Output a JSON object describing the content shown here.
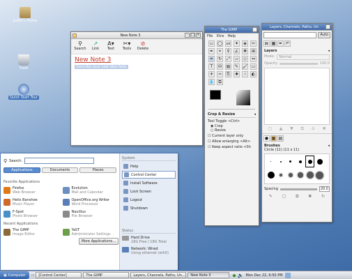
{
  "desktop": {
    "icons": [
      {
        "label": "judith's Home",
        "icon": "home-folder-icon"
      },
      {
        "label": "Trash",
        "icon": "trash-icon"
      },
      {
        "label": "Quick Start Tour",
        "icon": "help-icon"
      }
    ]
  },
  "note": {
    "title": "New Note 3",
    "toolbar": [
      {
        "label": "Search",
        "icon": "search-icon"
      },
      {
        "label": "Link",
        "icon": "link-icon"
      },
      {
        "label": "Text",
        "icon": "text-icon"
      },
      {
        "label": "Tools",
        "icon": "tools-icon"
      },
      {
        "label": "Delete",
        "icon": "delete-icon"
      }
    ],
    "heading": "New Note 3",
    "body": "Describe your new idea here."
  },
  "gimp_toolbox": {
    "title": "The GIMP",
    "menus": [
      "File",
      "Xtns",
      "Help"
    ],
    "options_title": "Crop & Resize",
    "tool_toggle": "Tool Toggle <Ctrl>",
    "radio_crop": "Crop",
    "radio_resize": "Resize",
    "opt_current_layer": "Current layer only",
    "opt_allow_enlarge": "Allow enlarging <Alt>",
    "opt_keep_aspect": "Keep aspect ratio <Sh"
  },
  "gimp_layers": {
    "title": "Layers, Channels, Paths, Un",
    "auto": "Auto",
    "layers_title": "Layers",
    "mode_label": "Mode:",
    "mode_value": "Normal",
    "opacity_label": "Opacity",
    "opacity_value": "100.0",
    "brushes_title": "Brushes",
    "brush_name": "Circle (11) (11 x 11)",
    "spacing_label": "Spacing",
    "spacing_value": "20.0"
  },
  "start_menu": {
    "search_label": "Search:",
    "tabs": [
      "Applications",
      "Documents",
      "Places"
    ],
    "favorites_title": "Favorite Applications",
    "favorites": [
      {
        "name": "Firefox",
        "desc": "Web Browser",
        "icon": "firefox-icon",
        "color": "#e07a18"
      },
      {
        "name": "Evolution",
        "desc": "Mail and Calendar",
        "icon": "evolution-icon",
        "color": "#6a8fc0"
      },
      {
        "name": "Helix Banshee",
        "desc": "Music Player",
        "icon": "banshee-icon",
        "color": "#d06a2c"
      },
      {
        "name": "OpenOffice.org Writer",
        "desc": "Word Processor",
        "icon": "writer-icon",
        "color": "#5a7fb8"
      },
      {
        "name": "F-Spot",
        "desc": "Photo Browser",
        "icon": "fspot-icon",
        "color": "#4a90c8"
      },
      {
        "name": "Nautilus",
        "desc": "File Browser",
        "icon": "nautilus-icon",
        "color": "#8a8a8a"
      }
    ],
    "recent_title": "Recent Applications",
    "recent": [
      {
        "name": "The GIMP",
        "desc": "Image Editor",
        "icon": "gimp-icon",
        "color": "#8b6a3a"
      },
      {
        "name": "YaST",
        "desc": "Administrator Settings",
        "icon": "yast-icon",
        "color": "#6aa04a"
      }
    ],
    "more_button": "More Applications...",
    "system_title": "System",
    "system_items": [
      {
        "label": "Help",
        "icon": "help-icon"
      },
      {
        "label": "Control Center",
        "icon": "control-center-icon"
      },
      {
        "label": "Install Software",
        "icon": "install-icon"
      },
      {
        "label": "Lock Screen",
        "icon": "lock-icon"
      },
      {
        "label": "Logout",
        "icon": "logout-icon"
      },
      {
        "label": "Shutdown",
        "icon": "shutdown-icon"
      }
    ],
    "status_title": "Status",
    "disk_name": "Hard Drive",
    "disk_desc": "18G Free / 18G Total",
    "net_name": "Network: Wired",
    "net_desc": "Using ethernet (eth0)"
  },
  "panel": {
    "computer_button": "Computer",
    "tasks": [
      "[Control Center]",
      "The GIMP",
      "Layers, Channels, Paths, Un...",
      "New Note 3"
    ],
    "clock": "Mon Dec 22, 6:50 PM"
  },
  "colors": {
    "selection": "#5a8ad0",
    "note_heading": "#c0392b",
    "panel_blue": "#3d72b8"
  }
}
